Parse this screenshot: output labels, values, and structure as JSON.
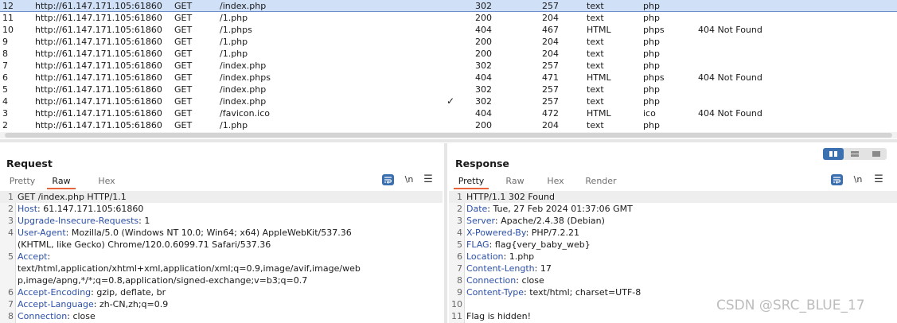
{
  "history": {
    "rows": [
      {
        "num": "12",
        "host": "http://61.147.171.105:61860",
        "method": "GET",
        "url": "/index.php",
        "edited": "",
        "status": "302",
        "length": "257",
        "mime": "text",
        "ext": "php",
        "title": "",
        "selected": true
      },
      {
        "num": "11",
        "host": "http://61.147.171.105:61860",
        "method": "GET",
        "url": "/1.php",
        "edited": "",
        "status": "200",
        "length": "204",
        "mime": "text",
        "ext": "php",
        "title": ""
      },
      {
        "num": "10",
        "host": "http://61.147.171.105:61860",
        "method": "GET",
        "url": "/1.phps",
        "edited": "",
        "status": "404",
        "length": "467",
        "mime": "HTML",
        "ext": "phps",
        "title": "404 Not Found"
      },
      {
        "num": "9",
        "host": "http://61.147.171.105:61860",
        "method": "GET",
        "url": "/1.php",
        "edited": "",
        "status": "200",
        "length": "204",
        "mime": "text",
        "ext": "php",
        "title": ""
      },
      {
        "num": "8",
        "host": "http://61.147.171.105:61860",
        "method": "GET",
        "url": "/1.php",
        "edited": "",
        "status": "200",
        "length": "204",
        "mime": "text",
        "ext": "php",
        "title": ""
      },
      {
        "num": "7",
        "host": "http://61.147.171.105:61860",
        "method": "GET",
        "url": "/index.php",
        "edited": "",
        "status": "302",
        "length": "257",
        "mime": "text",
        "ext": "php",
        "title": ""
      },
      {
        "num": "6",
        "host": "http://61.147.171.105:61860",
        "method": "GET",
        "url": "/index.phps",
        "edited": "",
        "status": "404",
        "length": "471",
        "mime": "HTML",
        "ext": "phps",
        "title": "404 Not Found"
      },
      {
        "num": "5",
        "host": "http://61.147.171.105:61860",
        "method": "GET",
        "url": "/index.php",
        "edited": "",
        "status": "302",
        "length": "257",
        "mime": "text",
        "ext": "php",
        "title": ""
      },
      {
        "num": "4",
        "host": "http://61.147.171.105:61860",
        "method": "GET",
        "url": "/index.php",
        "edited": "✓",
        "status": "302",
        "length": "257",
        "mime": "text",
        "ext": "php",
        "title": ""
      },
      {
        "num": "3",
        "host": "http://61.147.171.105:61860",
        "method": "GET",
        "url": "/favicon.ico",
        "edited": "",
        "status": "404",
        "length": "472",
        "mime": "HTML",
        "ext": "ico",
        "title": "404 Not Found"
      },
      {
        "num": "2",
        "host": "http://61.147.171.105:61860",
        "method": "GET",
        "url": "/1.php",
        "edited": "",
        "status": "200",
        "length": "204",
        "mime": "text",
        "ext": "php",
        "title": ""
      }
    ]
  },
  "request": {
    "title": "Request",
    "tabs": [
      "Pretty",
      "Raw",
      "Hex"
    ],
    "active_tab": "Raw",
    "newline_label": "\\n",
    "menu_label": "☰",
    "lines": [
      {
        "n": "1",
        "parts": [
          {
            "t": "GET /index.php HTTP/1.1",
            "k": "plain"
          }
        ]
      },
      {
        "n": "2",
        "parts": [
          {
            "t": "Host",
            "k": "name"
          },
          {
            "t": ": ",
            "k": "sep"
          },
          {
            "t": "61.147.171.105:61860",
            "k": "plain"
          }
        ]
      },
      {
        "n": "3",
        "parts": [
          {
            "t": "Upgrade-Insecure-Requests",
            "k": "name"
          },
          {
            "t": ": ",
            "k": "sep"
          },
          {
            "t": "1",
            "k": "plain"
          }
        ]
      },
      {
        "n": "4",
        "parts": [
          {
            "t": "User-Agent",
            "k": "name"
          },
          {
            "t": ": ",
            "k": "sep"
          },
          {
            "t": "Mozilla/5.0 (Windows NT 10.0; Win64; x64) AppleWebKit/537.36",
            "k": "plain"
          }
        ]
      },
      {
        "n": "",
        "parts": [
          {
            "t": "(KHTML, like Gecko) Chrome/120.0.6099.71 Safari/537.36",
            "k": "plain"
          }
        ]
      },
      {
        "n": "5",
        "parts": [
          {
            "t": "Accept",
            "k": "name"
          },
          {
            "t": ":",
            "k": "sep"
          }
        ]
      },
      {
        "n": "",
        "parts": [
          {
            "t": "text/html,application/xhtml+xml,application/xml;q=0.9,image/avif,image/web",
            "k": "plain"
          }
        ]
      },
      {
        "n": "",
        "parts": [
          {
            "t": "p,image/apng,*/*;q=0.8,application/signed-exchange;v=b3;q=0.7",
            "k": "plain"
          }
        ]
      },
      {
        "n": "6",
        "parts": [
          {
            "t": "Accept-Encoding",
            "k": "name"
          },
          {
            "t": ": ",
            "k": "sep"
          },
          {
            "t": "gzip, deflate, br",
            "k": "plain"
          }
        ]
      },
      {
        "n": "7",
        "parts": [
          {
            "t": "Accept-Language",
            "k": "name"
          },
          {
            "t": ": ",
            "k": "sep"
          },
          {
            "t": "zh-CN,zh;q=0.9",
            "k": "plain"
          }
        ]
      },
      {
        "n": "8",
        "parts": [
          {
            "t": "Connection",
            "k": "name"
          },
          {
            "t": ": ",
            "k": "sep"
          },
          {
            "t": "close",
            "k": "plain"
          }
        ]
      }
    ]
  },
  "response": {
    "title": "Response",
    "tabs": [
      "Pretty",
      "Raw",
      "Hex",
      "Render"
    ],
    "active_tab": "Pretty",
    "newline_label": "\\n",
    "menu_label": "☰",
    "lines": [
      {
        "n": "1",
        "parts": [
          {
            "t": "HTTP/1.1 302 Found",
            "k": "plain"
          }
        ]
      },
      {
        "n": "2",
        "parts": [
          {
            "t": "Date",
            "k": "name"
          },
          {
            "t": ": ",
            "k": "sep"
          },
          {
            "t": "Tue, 27 Feb 2024 01:37:06 GMT",
            "k": "plain"
          }
        ]
      },
      {
        "n": "3",
        "parts": [
          {
            "t": "Server",
            "k": "name"
          },
          {
            "t": ": ",
            "k": "sep"
          },
          {
            "t": "Apache/2.4.38 (Debian)",
            "k": "plain"
          }
        ]
      },
      {
        "n": "4",
        "parts": [
          {
            "t": "X-Powered-By",
            "k": "name"
          },
          {
            "t": ": ",
            "k": "sep"
          },
          {
            "t": "PHP/7.2.21",
            "k": "plain"
          }
        ]
      },
      {
        "n": "5",
        "parts": [
          {
            "t": "FLAG",
            "k": "name"
          },
          {
            "t": ": ",
            "k": "sep"
          },
          {
            "t": "flag{very_baby_web}",
            "k": "plain"
          }
        ]
      },
      {
        "n": "6",
        "parts": [
          {
            "t": "Location",
            "k": "name"
          },
          {
            "t": ": ",
            "k": "sep"
          },
          {
            "t": "1.php",
            "k": "plain"
          }
        ]
      },
      {
        "n": "7",
        "parts": [
          {
            "t": "Content-Length",
            "k": "name"
          },
          {
            "t": ": ",
            "k": "sep"
          },
          {
            "t": "17",
            "k": "plain"
          }
        ]
      },
      {
        "n": "8",
        "parts": [
          {
            "t": "Connection",
            "k": "name"
          },
          {
            "t": ": ",
            "k": "sep"
          },
          {
            "t": "close",
            "k": "plain"
          }
        ]
      },
      {
        "n": "9",
        "parts": [
          {
            "t": "Content-Type",
            "k": "name"
          },
          {
            "t": ": ",
            "k": "sep"
          },
          {
            "t": "text/html; charset=UTF-8",
            "k": "plain"
          }
        ]
      },
      {
        "n": "10",
        "parts": []
      },
      {
        "n": "11",
        "parts": [
          {
            "t": "Flag is hidden!",
            "k": "plain"
          }
        ]
      }
    ]
  },
  "watermark": "CSDN @SRC_BLUE_17",
  "colors": {
    "accent": "#3a6fb0",
    "header_name": "#2b4fa8",
    "active_tab_underline": "#e8643c",
    "selected_row": "#cfe0f7"
  }
}
